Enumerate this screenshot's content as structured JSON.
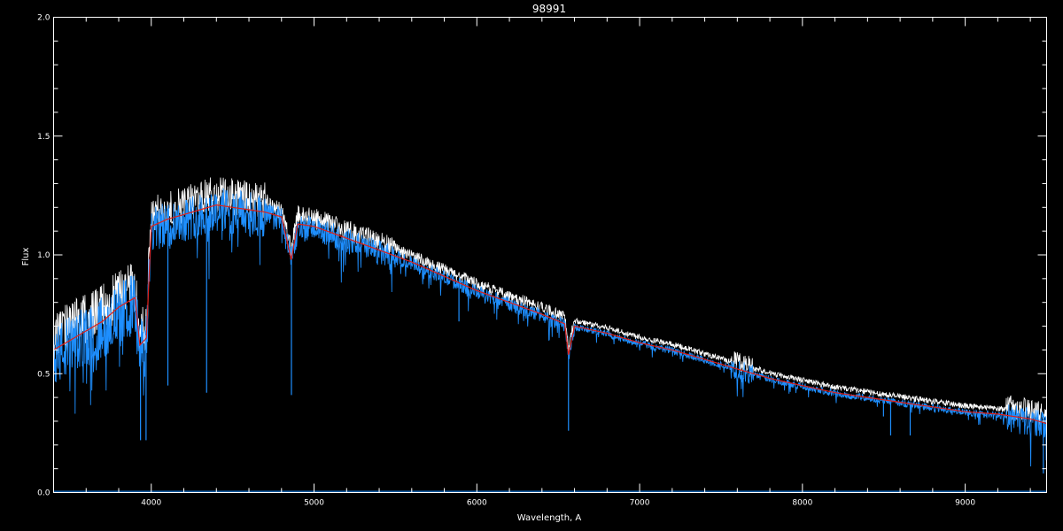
{
  "chart_data": {
    "type": "line",
    "title": "98991",
    "xlabel": "Wavelength, A",
    "ylabel": "Flux",
    "xlim": [
      3400,
      9500
    ],
    "ylim": [
      0.0,
      2.0
    ],
    "xticks": [
      4000,
      5000,
      6000,
      7000,
      8000,
      9000
    ],
    "yticks": [
      0.0,
      0.5,
      1.0,
      1.5,
      2.0
    ],
    "ytick_labels": [
      "0.0",
      "0.5",
      "1.0",
      "1.5",
      "2.0"
    ],
    "grid": false,
    "colors": {
      "background": "#000000",
      "axes": "#ffffff",
      "observed": "#ffffff",
      "model": "#1e8fff",
      "smoothed": "#e0201a"
    },
    "series": [
      {
        "color": "#e0201a",
        "x": [
          3400,
          3500,
          3600,
          3700,
          3800,
          3850,
          3900,
          3930,
          3970,
          4000,
          4100,
          4200,
          4300,
          4400,
          4500,
          4600,
          4700,
          4800,
          4860,
          4900,
          5000,
          5200,
          5400,
          5600,
          5800,
          6000,
          6200,
          6400,
          6540,
          6563,
          6600,
          6800,
          7000,
          7200,
          7400,
          7600,
          7800,
          8000,
          8200,
          8400,
          8600,
          8800,
          9000,
          9200,
          9400,
          9500
        ],
        "y": [
          0.6,
          0.64,
          0.68,
          0.72,
          0.78,
          0.8,
          0.82,
          0.62,
          0.65,
          1.12,
          1.15,
          1.17,
          1.19,
          1.21,
          1.2,
          1.19,
          1.18,
          1.16,
          0.98,
          1.13,
          1.12,
          1.07,
          1.02,
          0.97,
          0.91,
          0.85,
          0.8,
          0.75,
          0.71,
          0.58,
          0.7,
          0.67,
          0.63,
          0.6,
          0.56,
          0.52,
          0.48,
          0.45,
          0.42,
          0.4,
          0.38,
          0.36,
          0.34,
          0.33,
          0.31,
          0.29
        ]
      }
    ],
    "absorption_lines": [
      {
        "x": 3934,
        "y": 0.22
      },
      {
        "x": 3968,
        "y": 0.22
      },
      {
        "x": 4102,
        "y": 0.45
      },
      {
        "x": 4340,
        "y": 0.42
      },
      {
        "x": 4861,
        "y": 0.41
      },
      {
        "x": 5890,
        "y": 0.72
      },
      {
        "x": 6563,
        "y": 0.26
      },
      {
        "x": 8498,
        "y": 0.32
      },
      {
        "x": 8542,
        "y": 0.24
      },
      {
        "x": 8662,
        "y": 0.24
      },
      {
        "x": 9480,
        "y": 0.08
      }
    ]
  }
}
